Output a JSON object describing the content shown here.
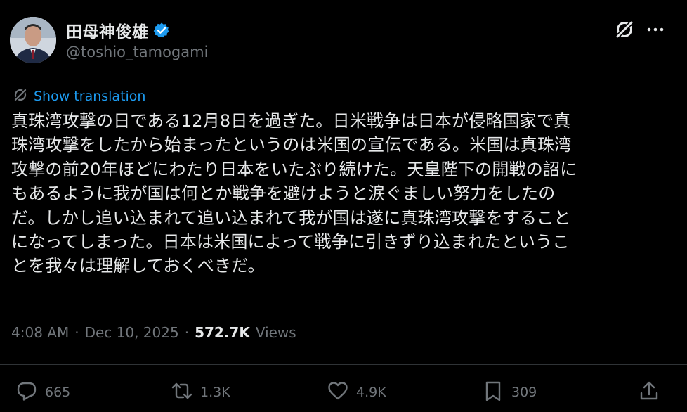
{
  "author": {
    "display_name": "田母神俊雄",
    "handle": "@toshio_tamogami",
    "verified": true
  },
  "translate": {
    "label": "Show translation"
  },
  "post": {
    "text": "真珠湾攻撃の日である12月8日を過ぎた。日米戦争は日本が侵略国家で真\n珠湾攻撃をしたから始まったというのは米国の宣伝である。米国は真珠湾\n攻撃の前20年ほどにわたり日本をいたぶり続けた。天皇陛下の開戦の詔に\nもあるように我が国は何とか戦争を避けようと涙ぐましい努力をしたの\nだ。しかし追い込まれて追い込まれて我が国は遂に真珠湾攻撃をすること\nになってしまった。日本は米国によって戦争に引きずり込まれたというこ\nとを我々は理解しておくべきだ。"
  },
  "meta": {
    "time": "4:08 AM",
    "sep1": "·",
    "date": "Dec 10, 2025",
    "sep2": "·",
    "views_count": "572.7K",
    "views_label": "Views"
  },
  "actions": {
    "replies": "665",
    "reposts": "1.3K",
    "likes": "4.9K",
    "bookmarks": "309"
  },
  "icons": {
    "verified": "verified-badge-icon",
    "grok": "grok-icon",
    "more": "more-icon",
    "translate": "translate-icon",
    "reply": "reply-icon",
    "repost": "repost-icon",
    "like": "like-icon",
    "bookmark": "bookmark-icon",
    "share": "share-icon"
  },
  "colors": {
    "background": "#000000",
    "text": "#e7e9ea",
    "muted": "#71767b",
    "accent": "#1d9bf0",
    "divider": "#2f3336"
  }
}
